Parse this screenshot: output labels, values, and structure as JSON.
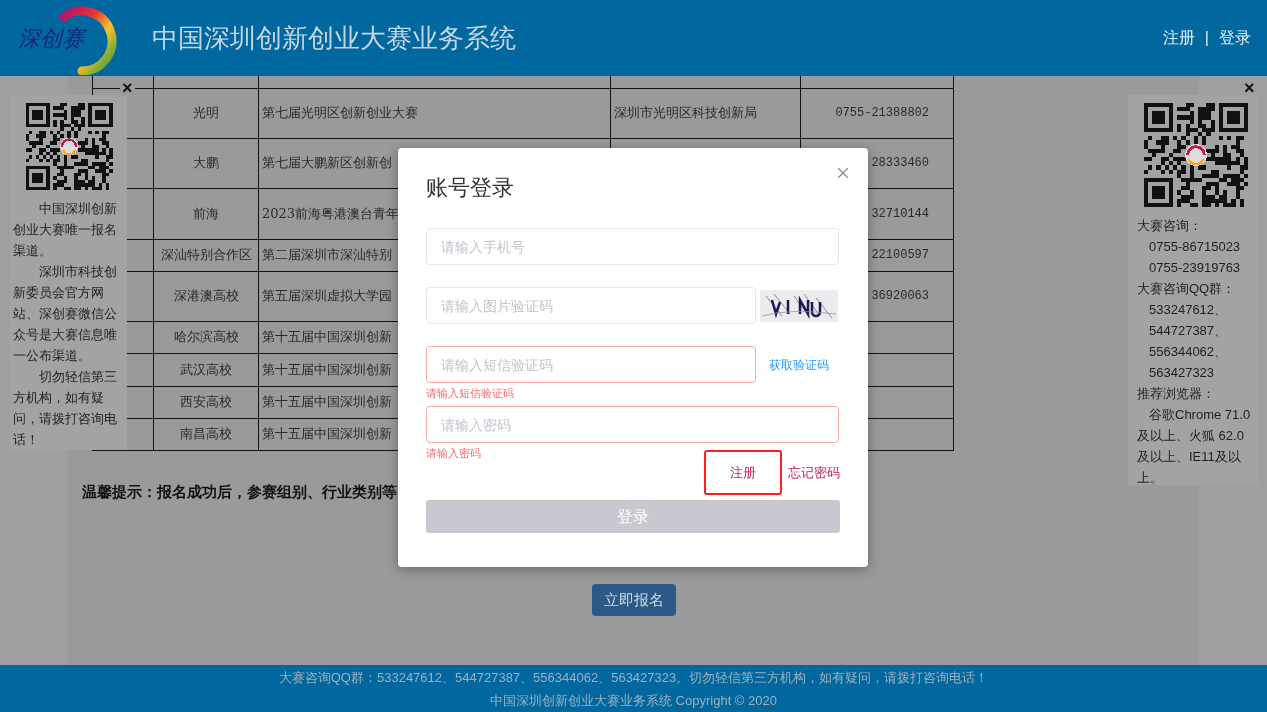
{
  "header": {
    "logo_text": "深创赛",
    "title": "中国深圳创新创业大赛业务系统",
    "links": [
      "注册",
      "登录"
    ],
    "separator": "|"
  },
  "table": {
    "rows": [
      {
        "region": "光明",
        "name": "第七届光明区创新创业大赛",
        "organizer": "深圳市光明区科技创新局",
        "phone": "0755-21388802"
      },
      {
        "region": "大鹏",
        "name": "第七届大鹏新区创新创",
        "organizer": "",
        "phone": "28333460"
      },
      {
        "region": "前海",
        "name": "2023前海粤港澳台青年",
        "organizer": "",
        "phone": "32710144"
      },
      {
        "region": "深汕特别合作区",
        "name": "第二届深圳市深汕特别",
        "organizer": "",
        "phone": "22100597"
      },
      {
        "region": "深港澳高校",
        "name": "第五届深圳虚拟大学园",
        "organizer": "",
        "phone": "36920063"
      },
      {
        "region": "哈尔滨高校",
        "name": "第十五届中国深圳创新",
        "organizer": "",
        "phone": ""
      },
      {
        "region": "武汉高校",
        "name": "第十五届中国深圳创新",
        "organizer": "",
        "phone": ""
      },
      {
        "region": "西安高校",
        "name": "第十五届中国深圳创新",
        "organizer": "",
        "phone": ""
      },
      {
        "region": "南昌高校",
        "name": "第十五届中国深圳创新",
        "organizer": "",
        "phone": ""
      }
    ]
  },
  "notice": "温馨提示：报名成功后，参赛组别、行业类别等",
  "signup_button": "立即报名",
  "left_panel": {
    "close": "×",
    "paragraphs": [
      "中国深圳创新创业大赛唯一报名渠道。",
      "深圳市科技创新委员会官方网站、深创赛微信公众号是大赛信息唯一公布渠道。",
      "切勿轻信第三方机构，如有疑问，请拨打咨询电话！"
    ]
  },
  "right_panel": {
    "close": "×",
    "lines": [
      {
        "kind": "heading",
        "text": "大赛咨询："
      },
      {
        "kind": "item",
        "text": "0755-86715023"
      },
      {
        "kind": "item",
        "text": "0755-23919763"
      },
      {
        "kind": "heading",
        "text": "大赛咨询QQ群："
      },
      {
        "kind": "item",
        "text": "533247612、"
      },
      {
        "kind": "item",
        "text": "544727387、"
      },
      {
        "kind": "item",
        "text": "556344062、"
      },
      {
        "kind": "item",
        "text": "563427323"
      },
      {
        "kind": "heading",
        "text": "推荐浏览器："
      },
      {
        "kind": "paragraph",
        "text": "谷歌Chrome 71.0及以上、火狐 62.0及以上、IE11及以上。"
      }
    ]
  },
  "login_dialog": {
    "title": "账号登录",
    "fields": [
      {
        "kind": "plain",
        "placeholder": "请输入手机号",
        "invalid": false
      },
      {
        "kind": "captcha",
        "placeholder": "请输入图片验证码",
        "invalid": false
      },
      {
        "kind": "sms",
        "placeholder": "请输入短信验证码",
        "invalid": true,
        "error": "请输入短信验证码",
        "action": "获取验证码"
      },
      {
        "kind": "plain",
        "placeholder": "请输入密码",
        "invalid": true,
        "error": "请输入密码"
      }
    ],
    "register": "注册",
    "forgot": "忘记密码",
    "submit": "登录",
    "submit_disabled": true
  },
  "footer": {
    "lines": [
      "大赛咨询QQ群：533247612、544727387、556344062、563427323。切勿轻信第三方机构，如有疑问，请拨打咨询电话！",
      "中国深圳创新创业大赛业务系统 Copyright © 2020"
    ]
  }
}
